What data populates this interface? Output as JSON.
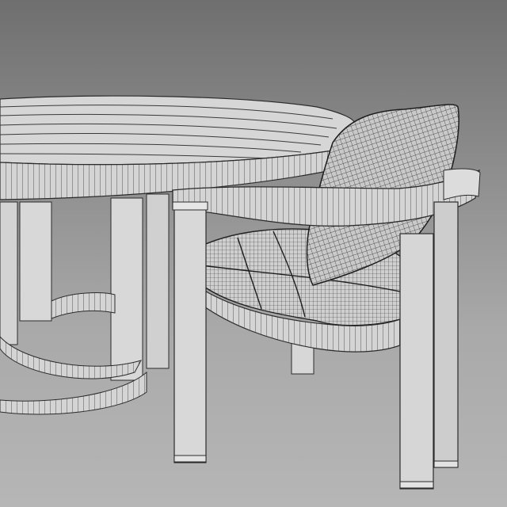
{
  "scene": {
    "subject": "wireframe-render-of-outdoor-dining-set",
    "colors": {
      "background_top": "#6f6f6f",
      "background_bottom": "#b6b6b6",
      "surface": "#d2d2d2",
      "surface_light": "#e1e1e1",
      "wire": "#2b2b2b"
    }
  }
}
